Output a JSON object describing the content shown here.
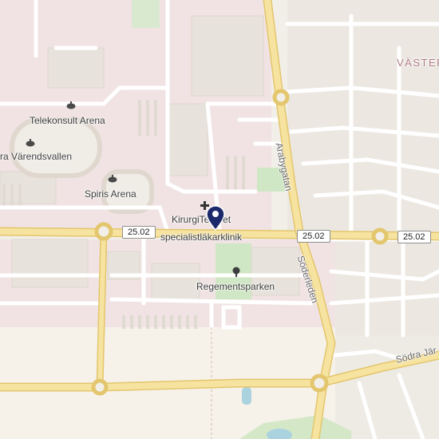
{
  "labels": {
    "district": "VÄSTER",
    "street_arabygatan": "Arabygatan",
    "street_soderleden": "Söderleden",
    "street_sodra_jarn": "Södra Jär",
    "poi_telekonsult": "Telekonsult Arena",
    "poi_varendsvallen": "ra Värendsvallen",
    "poi_spiris": "Spiris Arena",
    "poi_kirurgi": "KirurgiTeamet",
    "poi_specialist": "specialistläkarklinik",
    "poi_regementsparken": "Regementsparken"
  },
  "road_shields": [
    "25.02",
    "25.02",
    "25.02"
  ],
  "icons": {
    "arena": "stadium-icon",
    "clinic": "medical-cross-icon",
    "park": "tree-icon",
    "marker": "location-pin-icon"
  },
  "colors": {
    "land": "#f2efe9",
    "commercial": "#f1e3e3",
    "residential": "#ece8e1",
    "building": "#e7e3dc",
    "park": "#cfe7c4",
    "field": "#f6f2ea",
    "road": "#ffffff",
    "major_road": "#f6e3a0",
    "major_road_casing": "#e3c66d",
    "water": "#aad3df",
    "pin": "#1c2a6b"
  }
}
